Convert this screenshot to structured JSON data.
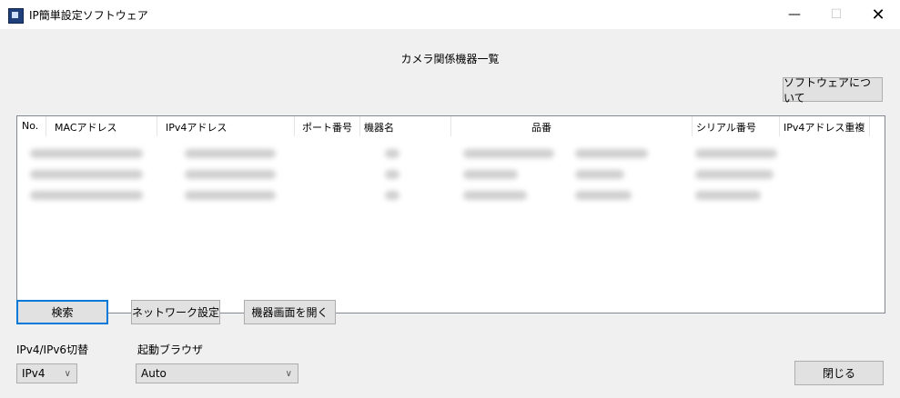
{
  "window": {
    "title": "IP簡単設定ソフトウェア",
    "minimize_glyph": "—",
    "maximize_glyph": "☐",
    "close_glyph": "✕"
  },
  "header": {
    "title": "カメラ関係機器一覧",
    "about_label": "ソフトウェアについて"
  },
  "list": {
    "columns": [
      "No.",
      "MACアドレス",
      "IPv4アドレス",
      "ポート番号",
      "機器名",
      "品番",
      "シリアル番号",
      "IPv4アドレス重複"
    ],
    "rows_blurred": 3
  },
  "toolbar": {
    "search_label": "検索",
    "network_label": "ネットワーク設定",
    "open_device_label": "機器画面を開く"
  },
  "ip_switch": {
    "label": "IPv4/IPv6切替",
    "value": "IPv4",
    "chevron": "∨"
  },
  "browser": {
    "label": "起動ブラウザ",
    "value": "Auto",
    "chevron": "∨"
  },
  "footer": {
    "close_label": "閉じる"
  }
}
